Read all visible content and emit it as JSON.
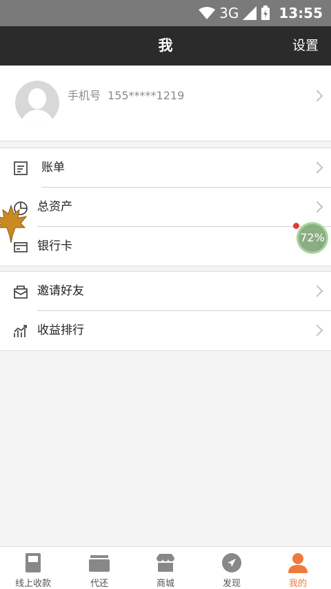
{
  "status_bar": {
    "network": "3G",
    "time": "13:55"
  },
  "header": {
    "title": "我",
    "settings_label": "设置"
  },
  "profile": {
    "phone_label": "手机号",
    "phone_number": "155*****1219"
  },
  "menu_groups": [
    {
      "items": [
        {
          "label": "账单",
          "icon": "bill-icon"
        },
        {
          "label": "总资产",
          "icon": "pie-chart-icon"
        },
        {
          "label": "银行卡",
          "icon": "bank-card-icon"
        }
      ]
    },
    {
      "items": [
        {
          "label": "邀请好友",
          "icon": "invite-icon"
        },
        {
          "label": "收益排行",
          "icon": "ranking-icon"
        }
      ]
    }
  ],
  "float_widget": {
    "text": "72%"
  },
  "tab_bar": {
    "tabs": [
      {
        "label": "线上收款",
        "icon": "pos-terminal-icon"
      },
      {
        "label": "代还",
        "icon": "cards-icon"
      },
      {
        "label": "商城",
        "icon": "store-icon"
      },
      {
        "label": "发现",
        "icon": "compass-icon"
      },
      {
        "label": "我的",
        "icon": "person-icon",
        "active": true
      }
    ],
    "active_color": "#f07a3c"
  }
}
